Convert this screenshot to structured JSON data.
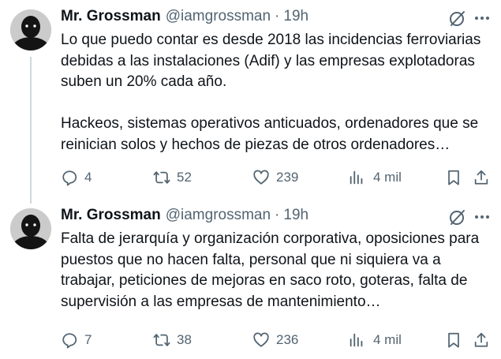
{
  "tweets": [
    {
      "author": {
        "name": "Mr. Grossman",
        "handle": "@iamgrossman"
      },
      "separator": "·",
      "time": "19h",
      "paragraphs": [
        "Lo que puedo contar es desde 2018 las incidencias ferroviarias debidas a las instalaciones (Adif) y las empresas explotadoras suben un 20% cada año.",
        "Hackeos, sistemas operativos anticuados, ordenadores que se reinician solos y hechos de piezas de otros ordenadores…"
      ],
      "stats": {
        "replies": "4",
        "reposts": "52",
        "likes": "239",
        "views": "4 mil"
      }
    },
    {
      "author": {
        "name": "Mr. Grossman",
        "handle": "@iamgrossman"
      },
      "separator": "·",
      "time": "19h",
      "paragraphs": [
        "Falta de jerarquía y organización corporativa, oposiciones para puestos que no hacen falta, personal que ni siquiera va a trabajar, peticiones de mejoras en saco roto, goteras, falta de supervisión a las empresas de mantenimiento…"
      ],
      "stats": {
        "replies": "7",
        "reposts": "38",
        "likes": "236",
        "views": "4 mil"
      }
    }
  ],
  "icons": {
    "grok": "grok-icon",
    "more": "more-icon",
    "reply": "reply-icon",
    "repost": "repost-icon",
    "like": "like-icon",
    "views": "views-icon",
    "bookmark": "bookmark-icon",
    "share": "share-icon"
  },
  "colors": {
    "text": "#0f1419",
    "secondary": "#536471",
    "thread_line": "#cfd9de"
  }
}
